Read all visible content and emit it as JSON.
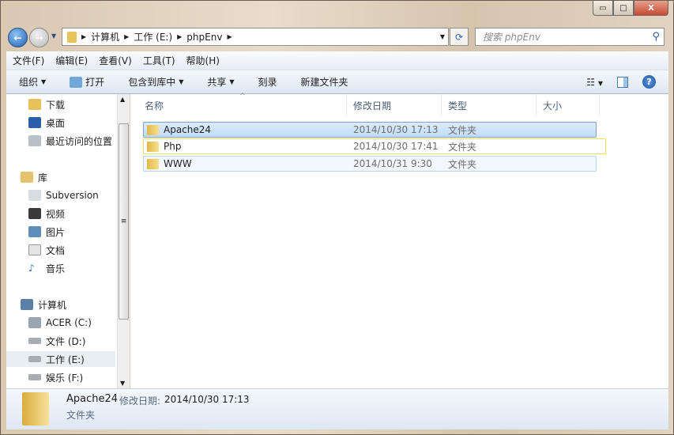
{
  "window": {
    "minimize": "▭",
    "maximize": "□",
    "close": "X"
  },
  "address": {
    "crumbs": [
      "计算机",
      "工作 (E:)",
      "phpEnv"
    ]
  },
  "search": {
    "placeholder": "搜索 phpEnv"
  },
  "menu": [
    "文件(F)",
    "编辑(E)",
    "查看(V)",
    "工具(T)",
    "帮助(H)"
  ],
  "toolbar": {
    "organize": "组织",
    "open": "打开",
    "include": "包含到库中",
    "share": "共享",
    "burn": "刻录",
    "new_folder": "新建文件夹"
  },
  "nav": {
    "favorites": [
      "下载",
      "桌面",
      "最近访问的位置"
    ],
    "libraries_label": "库",
    "libraries": [
      "Subversion",
      "视频",
      "图片",
      "文档",
      "音乐"
    ],
    "computer_label": "计算机",
    "drives": [
      "ACER (C:)",
      "文件 (D:)",
      "工作 (E:)",
      "娱乐 (F:)"
    ],
    "selected": "工作 (E:)"
  },
  "columns": [
    "名称",
    "修改日期",
    "类型",
    "大小"
  ],
  "files": [
    {
      "name": "Apache24",
      "date": "2014/10/30 17:13",
      "type": "文件夹"
    },
    {
      "name": "Php",
      "date": "2014/10/30 17:41",
      "type": "文件夹"
    },
    {
      "name": "WWW",
      "date": "2014/10/31 9:30",
      "type": "文件夹"
    }
  ],
  "details": {
    "name": "Apache24",
    "date_label": "修改日期:",
    "date": "2014/10/30 17:13",
    "type": "文件夹"
  }
}
